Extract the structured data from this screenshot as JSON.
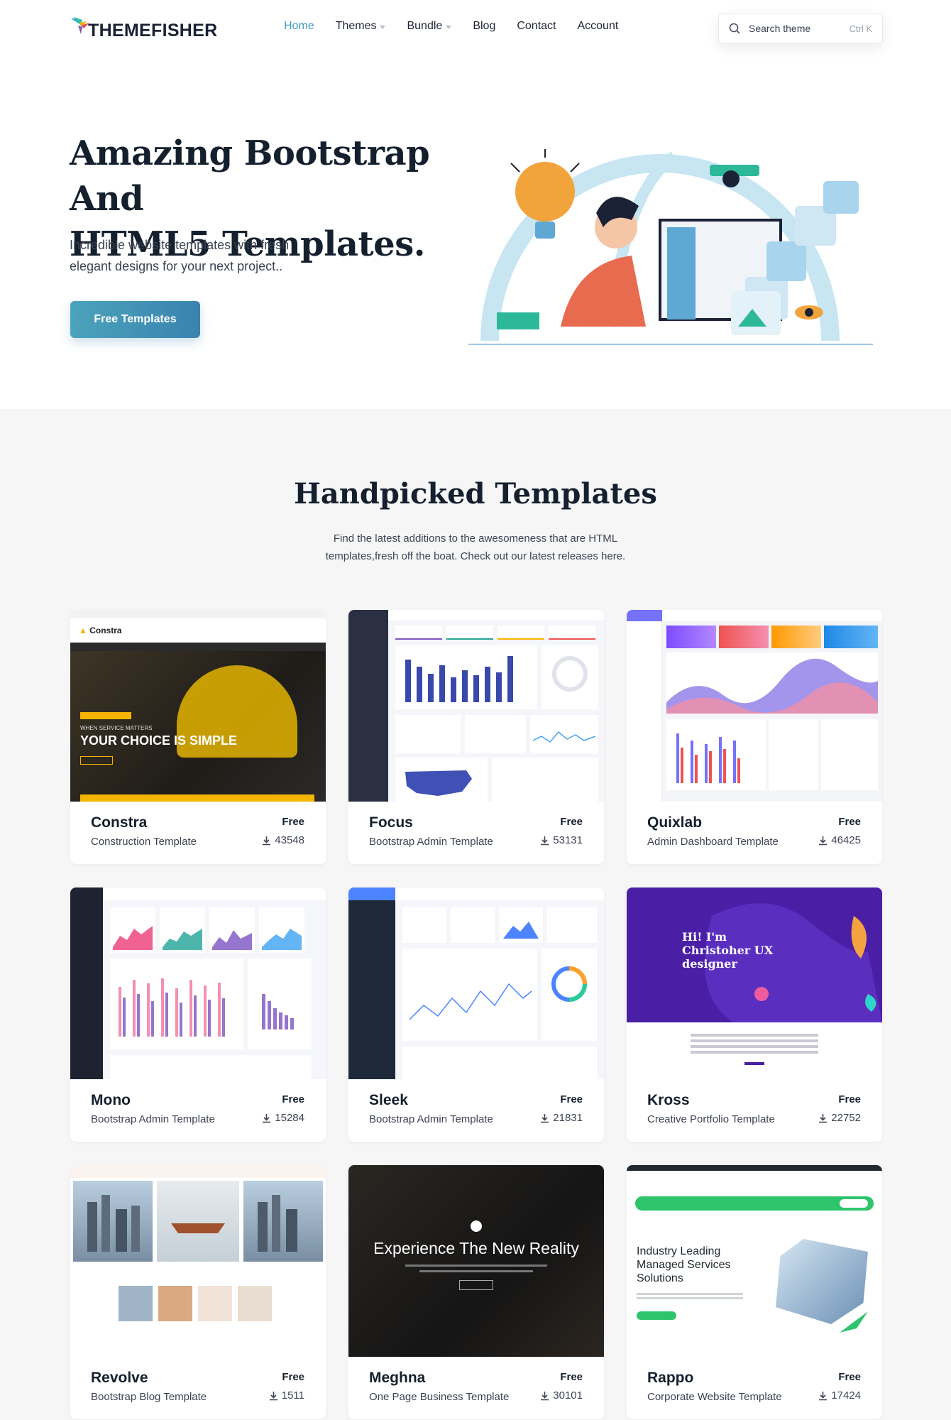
{
  "brand": {
    "name": "THEMEFISHER"
  },
  "nav": {
    "items": [
      {
        "label": "Home",
        "active": true,
        "dropdown": false
      },
      {
        "label": "Themes",
        "active": false,
        "dropdown": true
      },
      {
        "label": "Bundle",
        "active": false,
        "dropdown": true
      },
      {
        "label": "Blog",
        "active": false,
        "dropdown": false
      },
      {
        "label": "Contact",
        "active": false,
        "dropdown": false
      },
      {
        "label": "Account",
        "active": false,
        "dropdown": false
      }
    ]
  },
  "search": {
    "placeholder": "Search theme",
    "shortcut": "Ctrl K"
  },
  "hero": {
    "title_line1": "Amazing Bootstrap And",
    "title_line2": "HTML5 Templates.",
    "subtitle_line1": "Incredible website templates with fresh",
    "subtitle_line2": "elegant designs for your next project..",
    "cta": "Free Templates"
  },
  "section": {
    "title": "Handpicked Templates",
    "subtitle_line1": "Find the latest additions to the awesomeness that are HTML",
    "subtitle_line2": "templates,fresh off the boat. Check out our latest releases here."
  },
  "templates": [
    {
      "name": "Constra",
      "desc": "Construction Template",
      "price": "Free",
      "downloads": "43548",
      "thumb": "construction-site",
      "preview_headline": "YOUR CHOICE IS SIMPLE",
      "preview_kicker": "WHEN SERVICE MATTERS"
    },
    {
      "name": "Focus",
      "desc": "Bootstrap Admin Template",
      "price": "Free",
      "downloads": "53131",
      "thumb": "admin-bar-chart"
    },
    {
      "name": "Quixlab",
      "desc": "Admin Dashboard Template",
      "price": "Free",
      "downloads": "46425",
      "thumb": "admin-area-chart"
    },
    {
      "name": "Mono",
      "desc": "Bootstrap Admin Template",
      "price": "Free",
      "downloads": "15284",
      "thumb": "dark-admin"
    },
    {
      "name": "Sleek",
      "desc": "Bootstrap Admin Template",
      "price": "Free",
      "downloads": "21831",
      "thumb": "line-chart-admin"
    },
    {
      "name": "Kross",
      "desc": "Creative Portfolio Template",
      "price": "Free",
      "downloads": "22752",
      "thumb": "purple-portfolio",
      "preview_headline": "Hi! I'm Christoher UX designer"
    },
    {
      "name": "Revolve",
      "desc": "Bootstrap Blog Template",
      "price": "Free",
      "downloads": "1511",
      "thumb": "blog-gallery"
    },
    {
      "name": "Meghna",
      "desc": "One Page Business Template",
      "price": "Free",
      "downloads": "30101",
      "thumb": "dark-hero",
      "preview_headline": "Experience The New Reality"
    },
    {
      "name": "Rappo",
      "desc": "Corporate Website Template",
      "price": "Free",
      "downloads": "17424",
      "thumb": "corporate",
      "preview_headline": "Industry Leading Managed Services Solutions"
    }
  ]
}
